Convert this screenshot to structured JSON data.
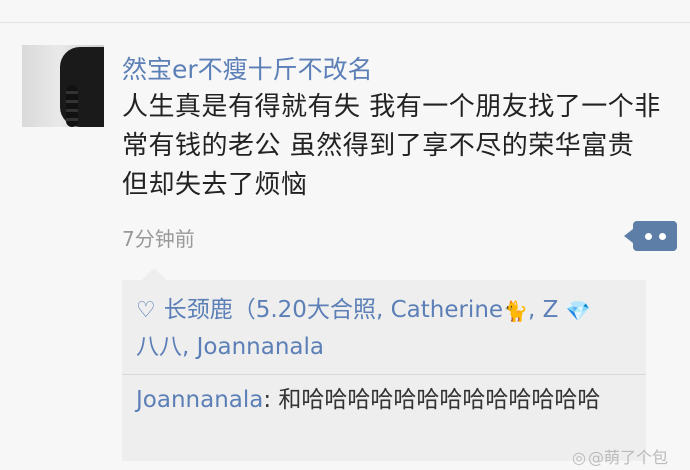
{
  "post": {
    "username": "然宝er不瘦十斤不改名",
    "text": "人生真是有得就有失 我有一个朋友找了一个非常有钱的老公 虽然得到了享不尽的荣华富贵 但却失去了烦恼",
    "timestamp": "7分钟前"
  },
  "likes": {
    "part1": "长颈鹿（5.20大合照, Catherine",
    "part2": ", Z",
    "part3": "八八, Joannanala"
  },
  "comment": {
    "author": "Joannanala",
    "text": ": 和哈哈哈哈哈哈哈哈哈哈哈哈哈"
  },
  "watermark": {
    "text": "@萌了个包"
  },
  "icons": {
    "heart": "heart-icon",
    "cat": "cat-emoji-icon",
    "gem": "gem-emoji-icon",
    "more": "more-dots-icon",
    "weibo": "weibo-icon"
  },
  "colors": {
    "link": "#5b7fb6",
    "more_button": "#5d7ea6",
    "comment_bg": "#eeeeee"
  }
}
